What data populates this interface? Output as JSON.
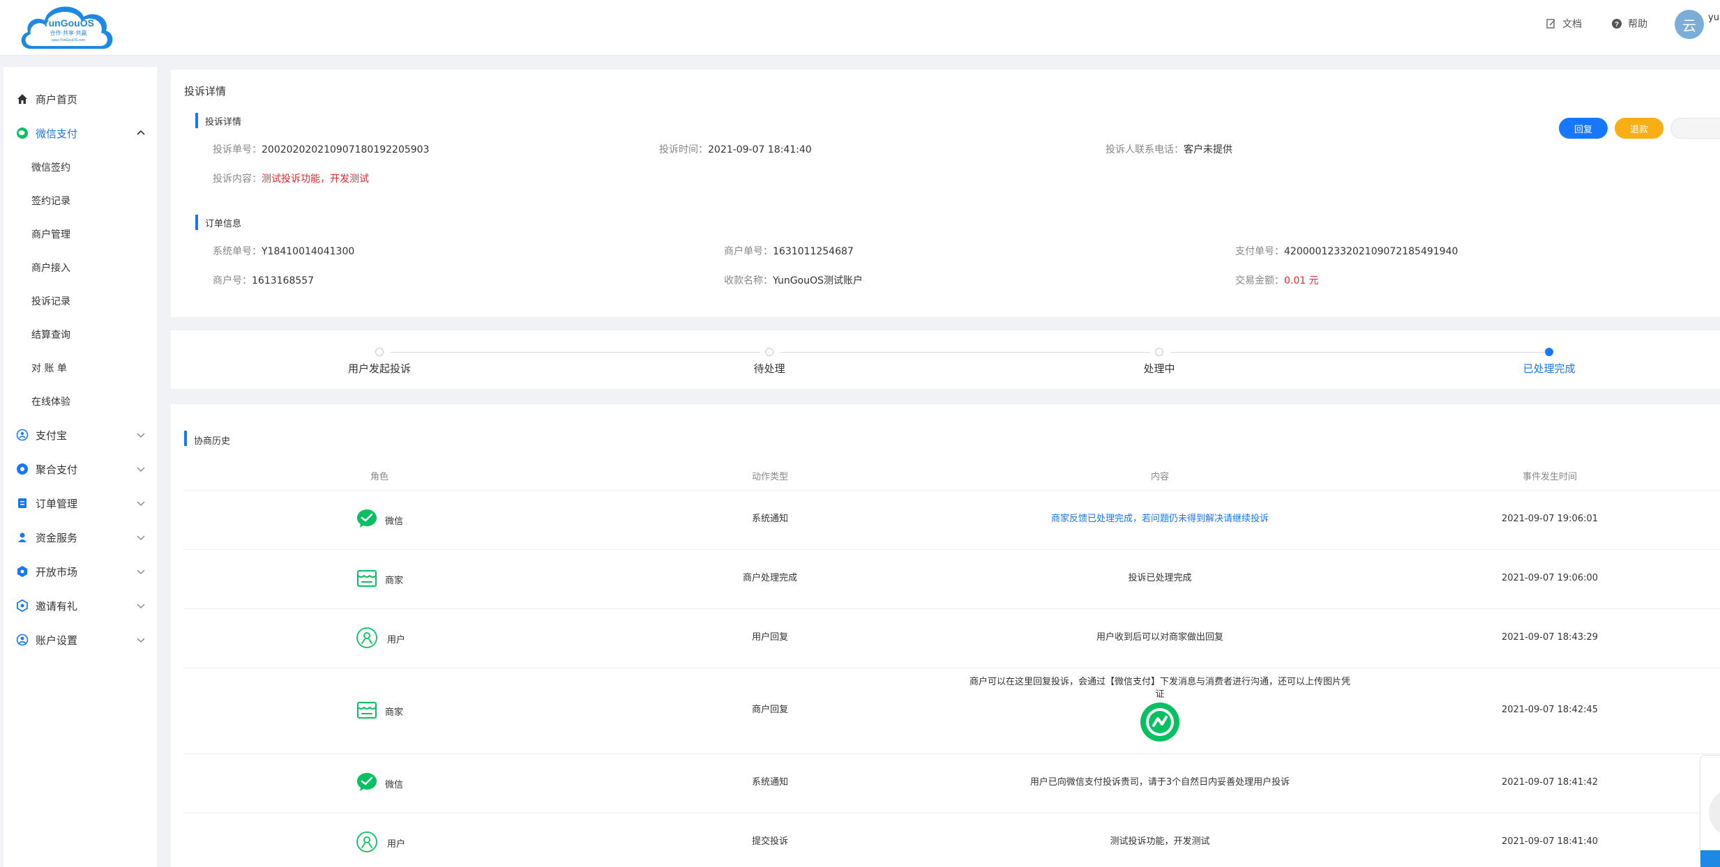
{
  "header": {
    "logo_text": "YunGouOS",
    "logo_slogan": "合作·共享·共赢",
    "logo_url": "www.YunGouOS.com",
    "docs_label": "文档",
    "help_label": "帮助",
    "avatar_char": "云",
    "user_name": "yu"
  },
  "sidebar": {
    "items": [
      {
        "label": "商户首页",
        "icon": "home-icon"
      },
      {
        "label": "微信支付",
        "icon": "wechat-icon"
      },
      {
        "label": "支付宝",
        "icon": "alipay-icon"
      },
      {
        "label": "聚合支付",
        "icon": "aggregate-pay-icon"
      },
      {
        "label": "订单管理",
        "icon": "order-icon"
      },
      {
        "label": "资金服务",
        "icon": "fund-icon"
      },
      {
        "label": "开放市场",
        "icon": "market-icon"
      },
      {
        "label": "邀请有礼",
        "icon": "gift-icon"
      },
      {
        "label": "账户设置",
        "icon": "account-icon"
      }
    ],
    "sub_items": [
      "微信签约",
      "签约记录",
      "商户管理",
      "商户接入",
      "投诉记录",
      "结算查询",
      "对 账 单",
      "在线体验"
    ]
  },
  "complaint": {
    "card_title": "投诉详情",
    "section_title": "投诉详情",
    "no_label": "投诉单号：",
    "no_value": "20020202021090718019220590­3",
    "time_label": "投诉时间：",
    "time_value": "2021-09-07 18:41:40",
    "phone_label": "投诉人联系电话：",
    "phone_value": "客户未提供",
    "content_label": "投诉内容：",
    "content_value": "测试投诉功能，开发测试",
    "reply_button": "回复",
    "refund_button": "退款"
  },
  "order": {
    "section_title": "订单信息",
    "sys_no_label": "系统单号：",
    "sys_no_value": "Y18410014041300",
    "merchant_order_label": "商户单号：",
    "merchant_order_value": "1631011254687",
    "pay_no_label": "支付单号：",
    "pay_no_value": "4200001233202109072185491940",
    "merchant_id_label": "商户号：",
    "merchant_id_value": "1613168557",
    "payee_label": "收款名称：",
    "payee_value": "YunGouOS测试账户",
    "amount_label": "交易金额：",
    "amount_value": "0.01 元"
  },
  "steps": [
    "用户发起投诉",
    "待处理",
    "处理中",
    "已处理完成"
  ],
  "history": {
    "title": "协商历史",
    "columns": [
      "角色",
      "动作类型",
      "内容",
      "事件发生时间"
    ],
    "rows": [
      {
        "role": "微信",
        "role_icon": "wechat-check-icon",
        "action": "系统通知",
        "content": "商家反馈已处理完成，若问题仍未得到解决请继续投诉",
        "time": "2021-09-07 19:06:01"
      },
      {
        "role": "商家",
        "role_icon": "merchant-icon",
        "action": "商户处理完成",
        "content": "投诉已处理完成",
        "time": "2021-09-07 19:06:00"
      },
      {
        "role": "用户",
        "role_icon": "user-icon",
        "action": "用户回复",
        "content": "用户收到后可以对商家做出回复",
        "time": "2021-09-07 18:43:29"
      },
      {
        "role": "商家",
        "role_icon": "merchant-icon",
        "action": "商户回复",
        "content": "商户可以在这里回复投诉，会通过【微信支付】下发消息与消费者进行沟通，还可以上传图片凭证",
        "time": "2021-09-07 18:42:45"
      },
      {
        "role": "微信",
        "role_icon": "wechat-check-icon",
        "action": "系统通知",
        "content": "用户已向微信支付投诉贵司，请于3个自然日内妥善处理用户投诉",
        "time": "2021-09-07 18:41:42"
      },
      {
        "role": "用户",
        "role_icon": "user-icon",
        "action": "提交投诉",
        "content": "测试投诉功能，开发测试",
        "time": "2021-09-07 18:41:40"
      }
    ]
  },
  "colors": {
    "accent": "#1677ff",
    "warning": "#faad14",
    "danger": "#f5222d",
    "wechat_green": "#07c160"
  }
}
